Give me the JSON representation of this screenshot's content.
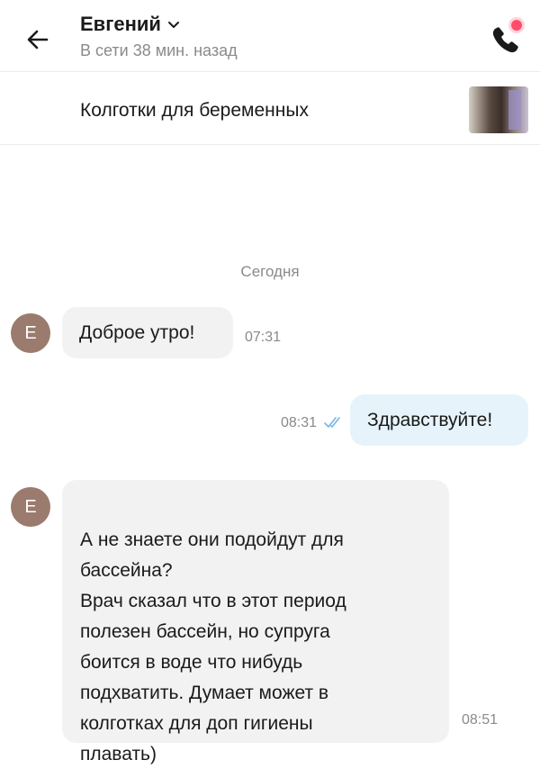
{
  "header": {
    "back_icon": "arrow-left-icon",
    "contact_name": "Евгений",
    "chevron_icon": "chevron-down-icon",
    "status": "В сети 38 мин. назад",
    "call_icon": "phone-icon",
    "notification_color": "#ff4d6a"
  },
  "product": {
    "title": "Колготки для беременных",
    "thumbnail_icon": "product-thumbnail"
  },
  "chat": {
    "day_separator": "Сегодня",
    "messages": [
      {
        "direction": "incoming",
        "avatar_letter": "Е",
        "text": "Доброе утро!",
        "time": "07:31"
      },
      {
        "direction": "outgoing",
        "text": "Здравствуйте!",
        "time": "08:31",
        "read_icon": "double-check-icon"
      },
      {
        "direction": "incoming",
        "avatar_letter": "Е",
        "text": "А не знаете они подойдут для\nбассейна?\nВрач сказал что в этот период\nполезен бассейн, но супруга\nбоится в воде что нибудь\nподхватить. Думает может в\nколготках для доп гигиены\nплавать)",
        "time": "08:51"
      }
    ]
  },
  "colors": {
    "incoming_bubble": "#f2f2f2",
    "outgoing_bubble": "#e6f3fb",
    "avatar": "#9a7b6e",
    "read_check": "#6fb8e6"
  }
}
